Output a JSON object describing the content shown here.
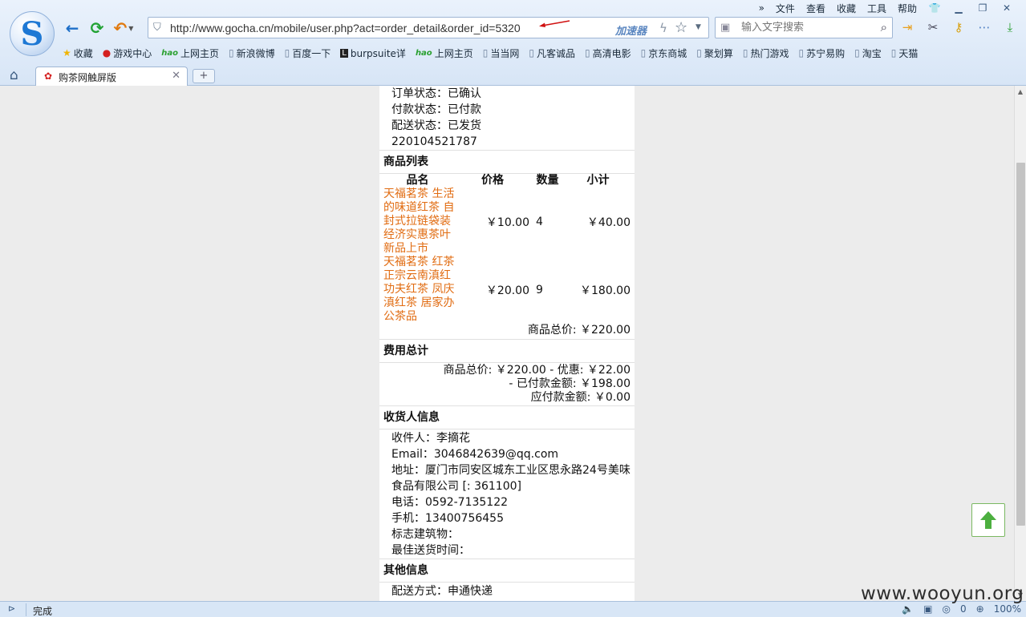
{
  "browser": {
    "menu": [
      "»",
      "文件",
      "查看",
      "收藏",
      "工具",
      "帮助"
    ],
    "url": "http://www.gocha.cn/mobile/user.php?act=order_detail&order_id=5320",
    "accelerator": "加速器",
    "search_placeholder": "输入文字搜索",
    "favorites": [
      "收藏",
      "游戏中心",
      "上网主页",
      "新浪微博",
      "百度一下",
      "burpsuite详",
      "上网主页",
      "当当网",
      "凡客诚品",
      "高清电影",
      "京东商城",
      "聚划算",
      "热门游戏",
      "苏宁易购",
      "淘宝",
      "天猫"
    ],
    "tab_title": "购茶网触屏版",
    "new_tab": "+",
    "status_text": "完成",
    "status_right": [
      "0",
      "100%"
    ]
  },
  "order": {
    "status_lines": [
      "订单状态：已确认",
      "付款状态：已付款",
      "配送状态：已发货",
      "220104521787"
    ],
    "goods_heading": "商品列表",
    "columns": [
      "品名",
      "价格",
      "数量",
      "小计"
    ],
    "items": [
      {
        "name": "天福茗茶 生活的味道红茶 自封式拉链袋装 经济实惠茶叶 新品上市",
        "price": "￥10.00",
        "qty": "4",
        "subtotal": "￥40.00"
      },
      {
        "name": "天福茗茶 红茶 正宗云南滇红 功夫红茶 凤庆滇红茶 居家办公茶品",
        "price": "￥20.00",
        "qty": "9",
        "subtotal": "￥180.00"
      }
    ],
    "goods_total": "商品总价: ￥220.00",
    "fees_heading": "费用总计",
    "fees_lines": [
      "商品总价: ￥220.00 - 优惠: ￥22.00",
      "- 已付款金额: ￥198.00",
      "应付款金额: ￥0.00"
    ],
    "consignee_heading": "收货人信息",
    "consignee_lines": [
      "收件人：李摘花",
      "Email：3046842639@qq.com",
      "地址：厦门市同安区城东工业区思永路24号美味",
      "食品有限公司 [: 361100]",
      "电话：0592-7135122",
      "手机：13400756455",
      "标志建筑物：",
      "最佳送货时间："
    ],
    "other_heading": "其他信息",
    "other_lines": [
      "配送方式：申通快递"
    ]
  },
  "watermark": "www.wooyun.org",
  "colors": {
    "product_link": "#e16c12",
    "accent_green": "#4caf3f"
  }
}
